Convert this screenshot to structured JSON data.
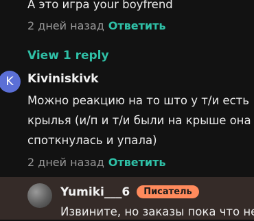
{
  "prev_comment": {
    "last_line": "А это игра your boyfrend",
    "time": "2 дней назад",
    "reply_label": "Ответить"
  },
  "view_replies_label": "View 1 reply",
  "comment": {
    "avatar_letter": "K",
    "avatar_color": "#5b6fd6",
    "username": "Kiviniskivk",
    "lines": [
      "Можно реакцию на то што у т/и есть",
      "крылья (и/п и т/и были на крыше она",
      "споткнулась и упала)"
    ],
    "time": "2 дней назад",
    "reply_label": "Ответить"
  },
  "author_reply": {
    "username": "Yumiki___6",
    "badge": "Писатель",
    "badge_color": "#ff8a5c",
    "partial_text": "Извините, но заказы пока что не"
  },
  "colors": {
    "accent": "#2fc0a7",
    "highlight_bg": "#352b28",
    "background": "#121212"
  }
}
